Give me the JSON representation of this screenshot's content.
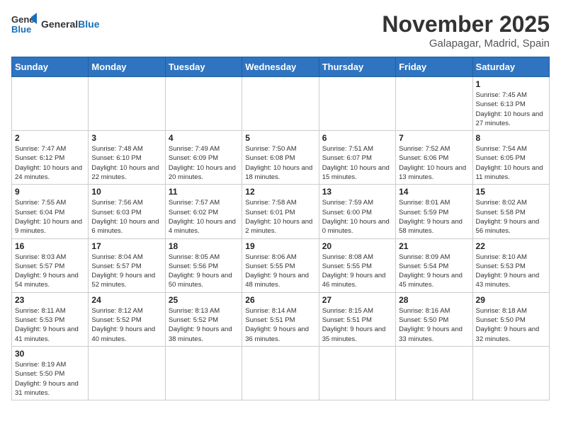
{
  "header": {
    "logo_general": "General",
    "logo_blue": "Blue",
    "month": "November 2025",
    "location": "Galapagar, Madrid, Spain"
  },
  "days_of_week": [
    "Sunday",
    "Monday",
    "Tuesday",
    "Wednesday",
    "Thursday",
    "Friday",
    "Saturday"
  ],
  "weeks": [
    [
      {
        "day": "",
        "info": ""
      },
      {
        "day": "",
        "info": ""
      },
      {
        "day": "",
        "info": ""
      },
      {
        "day": "",
        "info": ""
      },
      {
        "day": "",
        "info": ""
      },
      {
        "day": "",
        "info": ""
      },
      {
        "day": "1",
        "info": "Sunrise: 7:45 AM\nSunset: 6:13 PM\nDaylight: 10 hours and 27 minutes."
      }
    ],
    [
      {
        "day": "2",
        "info": "Sunrise: 7:47 AM\nSunset: 6:12 PM\nDaylight: 10 hours and 24 minutes."
      },
      {
        "day": "3",
        "info": "Sunrise: 7:48 AM\nSunset: 6:10 PM\nDaylight: 10 hours and 22 minutes."
      },
      {
        "day": "4",
        "info": "Sunrise: 7:49 AM\nSunset: 6:09 PM\nDaylight: 10 hours and 20 minutes."
      },
      {
        "day": "5",
        "info": "Sunrise: 7:50 AM\nSunset: 6:08 PM\nDaylight: 10 hours and 18 minutes."
      },
      {
        "day": "6",
        "info": "Sunrise: 7:51 AM\nSunset: 6:07 PM\nDaylight: 10 hours and 15 minutes."
      },
      {
        "day": "7",
        "info": "Sunrise: 7:52 AM\nSunset: 6:06 PM\nDaylight: 10 hours and 13 minutes."
      },
      {
        "day": "8",
        "info": "Sunrise: 7:54 AM\nSunset: 6:05 PM\nDaylight: 10 hours and 11 minutes."
      }
    ],
    [
      {
        "day": "9",
        "info": "Sunrise: 7:55 AM\nSunset: 6:04 PM\nDaylight: 10 hours and 9 minutes."
      },
      {
        "day": "10",
        "info": "Sunrise: 7:56 AM\nSunset: 6:03 PM\nDaylight: 10 hours and 6 minutes."
      },
      {
        "day": "11",
        "info": "Sunrise: 7:57 AM\nSunset: 6:02 PM\nDaylight: 10 hours and 4 minutes."
      },
      {
        "day": "12",
        "info": "Sunrise: 7:58 AM\nSunset: 6:01 PM\nDaylight: 10 hours and 2 minutes."
      },
      {
        "day": "13",
        "info": "Sunrise: 7:59 AM\nSunset: 6:00 PM\nDaylight: 10 hours and 0 minutes."
      },
      {
        "day": "14",
        "info": "Sunrise: 8:01 AM\nSunset: 5:59 PM\nDaylight: 9 hours and 58 minutes."
      },
      {
        "day": "15",
        "info": "Sunrise: 8:02 AM\nSunset: 5:58 PM\nDaylight: 9 hours and 56 minutes."
      }
    ],
    [
      {
        "day": "16",
        "info": "Sunrise: 8:03 AM\nSunset: 5:57 PM\nDaylight: 9 hours and 54 minutes."
      },
      {
        "day": "17",
        "info": "Sunrise: 8:04 AM\nSunset: 5:57 PM\nDaylight: 9 hours and 52 minutes."
      },
      {
        "day": "18",
        "info": "Sunrise: 8:05 AM\nSunset: 5:56 PM\nDaylight: 9 hours and 50 minutes."
      },
      {
        "day": "19",
        "info": "Sunrise: 8:06 AM\nSunset: 5:55 PM\nDaylight: 9 hours and 48 minutes."
      },
      {
        "day": "20",
        "info": "Sunrise: 8:08 AM\nSunset: 5:55 PM\nDaylight: 9 hours and 46 minutes."
      },
      {
        "day": "21",
        "info": "Sunrise: 8:09 AM\nSunset: 5:54 PM\nDaylight: 9 hours and 45 minutes."
      },
      {
        "day": "22",
        "info": "Sunrise: 8:10 AM\nSunset: 5:53 PM\nDaylight: 9 hours and 43 minutes."
      }
    ],
    [
      {
        "day": "23",
        "info": "Sunrise: 8:11 AM\nSunset: 5:53 PM\nDaylight: 9 hours and 41 minutes."
      },
      {
        "day": "24",
        "info": "Sunrise: 8:12 AM\nSunset: 5:52 PM\nDaylight: 9 hours and 40 minutes."
      },
      {
        "day": "25",
        "info": "Sunrise: 8:13 AM\nSunset: 5:52 PM\nDaylight: 9 hours and 38 minutes."
      },
      {
        "day": "26",
        "info": "Sunrise: 8:14 AM\nSunset: 5:51 PM\nDaylight: 9 hours and 36 minutes."
      },
      {
        "day": "27",
        "info": "Sunrise: 8:15 AM\nSunset: 5:51 PM\nDaylight: 9 hours and 35 minutes."
      },
      {
        "day": "28",
        "info": "Sunrise: 8:16 AM\nSunset: 5:50 PM\nDaylight: 9 hours and 33 minutes."
      },
      {
        "day": "29",
        "info": "Sunrise: 8:18 AM\nSunset: 5:50 PM\nDaylight: 9 hours and 32 minutes."
      }
    ],
    [
      {
        "day": "30",
        "info": "Sunrise: 8:19 AM\nSunset: 5:50 PM\nDaylight: 9 hours and 31 minutes."
      },
      {
        "day": "",
        "info": ""
      },
      {
        "day": "",
        "info": ""
      },
      {
        "day": "",
        "info": ""
      },
      {
        "day": "",
        "info": ""
      },
      {
        "day": "",
        "info": ""
      },
      {
        "day": "",
        "info": ""
      }
    ]
  ]
}
